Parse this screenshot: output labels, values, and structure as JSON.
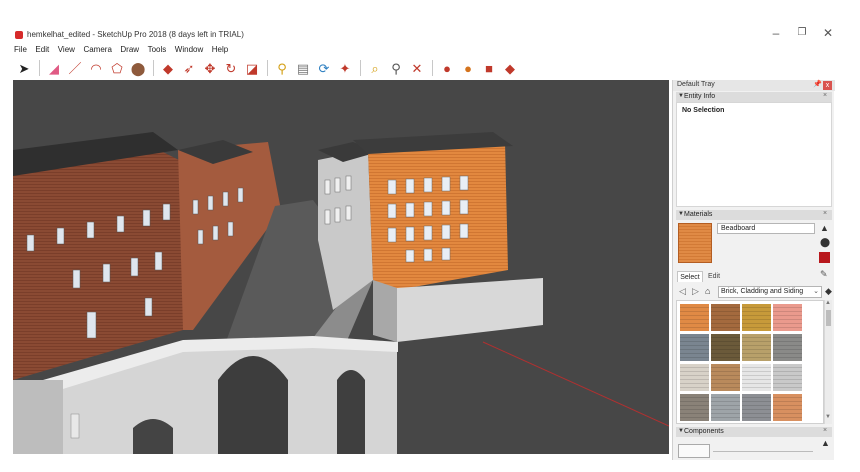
{
  "window": {
    "title": "hemkelhat_edited - SketchUp Pro 2018 (8 days left in TRIAL)",
    "min_glyph": "–",
    "max_glyph": "❐",
    "close_glyph": "✕"
  },
  "menu": [
    "File",
    "Edit",
    "View",
    "Camera",
    "Draw",
    "Tools",
    "Window",
    "Help"
  ],
  "toolbar": [
    {
      "name": "select-tool",
      "glyph": "➤",
      "color": "#222222"
    },
    {
      "name": "eraser-tool",
      "glyph": "◢",
      "color": "#e05a84"
    },
    {
      "name": "line-tool",
      "glyph": "／",
      "color": "#c0392b"
    },
    {
      "name": "arc-tool",
      "glyph": "◠",
      "color": "#c0392b"
    },
    {
      "name": "shapes-tool",
      "glyph": "⬠",
      "color": "#c0392b"
    },
    {
      "name": "paint-bucket-tool",
      "glyph": "⬤",
      "color": "#8e5a3c"
    },
    {
      "name": "push-pull-tool",
      "glyph": "◆",
      "color": "#c0392b"
    },
    {
      "name": "follow-me-tool",
      "glyph": "➶",
      "color": "#c0392b"
    },
    {
      "name": "move-tool",
      "glyph": "✥",
      "color": "#c0392b"
    },
    {
      "name": "rotate-tool",
      "glyph": "↻",
      "color": "#c0392b"
    },
    {
      "name": "scale-tool",
      "glyph": "◪",
      "color": "#c0392b"
    },
    {
      "name": "tape-measure-tool",
      "glyph": "⚲",
      "color": "#d4a017"
    },
    {
      "name": "text-tool",
      "glyph": "▤",
      "color": "#777777"
    },
    {
      "name": "orbit-tool",
      "glyph": "⟳",
      "color": "#2d7fc1"
    },
    {
      "name": "pan-tool",
      "glyph": "✦",
      "color": "#c0392b"
    },
    {
      "name": "zoom-tool",
      "glyph": "⌕",
      "color": "#d4a017"
    },
    {
      "name": "zoom-window-tool",
      "glyph": "⚲",
      "color": "#555555"
    },
    {
      "name": "zoom-extents-tool",
      "glyph": "✕",
      "color": "#c0392b"
    },
    {
      "name": "warehouse-tool",
      "glyph": "●",
      "color": "#c0392b"
    },
    {
      "name": "share-model-tool",
      "glyph": "●",
      "color": "#d4731d"
    },
    {
      "name": "extension-warehouse-tool",
      "glyph": "■",
      "color": "#c0392b"
    },
    {
      "name": "ruby-tool",
      "glyph": "◆",
      "color": "#c0392b"
    }
  ],
  "tray": {
    "title": "Default Tray",
    "pin_glyph": "📌",
    "close_glyph": "x",
    "entity_info": {
      "label": "Entity Info",
      "status": "No Selection"
    },
    "materials": {
      "label": "Materials",
      "current_name": "Beadboard",
      "tab_select": "Select",
      "tab_edit": "Edit",
      "collection": "Brick, Cladding and Siding",
      "swatches": [
        "#e08a45",
        "#a46a3e",
        "#c79a3a",
        "#ea9a8d",
        "#7a8590",
        "#6b5a3a",
        "#b8a06a",
        "#8a8a88",
        "#d8d2c8",
        "#b98a5c",
        "#e6e6e6",
        "#c9c9c9",
        "#8a8278",
        "#9ea4a8",
        "#8d8f94",
        "#d89060"
      ],
      "color_chip": "#b8181c"
    },
    "components": {
      "label": "Components"
    }
  },
  "viewport": {
    "background": "#474747"
  }
}
